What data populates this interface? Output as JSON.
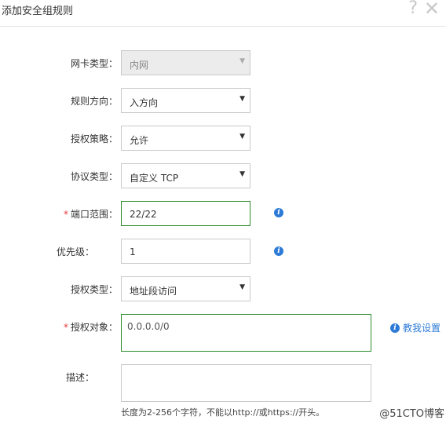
{
  "dialog": {
    "title": "添加安全组规则",
    "help_symbol": "?",
    "close_symbol": "✕"
  },
  "form": {
    "nic_type": {
      "label": "网卡类型：",
      "value": "内网"
    },
    "direction": {
      "label": "规则方向：",
      "value": "入方向"
    },
    "policy": {
      "label": "授权策略：",
      "value": "允许"
    },
    "protocol": {
      "label": "协议类型：",
      "value": "自定义 TCP"
    },
    "port_range": {
      "label": "端口范围：",
      "required_mark": "*",
      "value": "22/22"
    },
    "priority": {
      "label": "优先级：",
      "value": "1"
    },
    "auth_type": {
      "label": "授权类型：",
      "value": "地址段访问"
    },
    "auth_object": {
      "label": "授权对象：",
      "required_mark": "*",
      "value": "0.0.0.0/0",
      "help_link": "教我设置"
    },
    "description": {
      "label": "描述：",
      "value": "",
      "hint": "长度为2-256个字符，不能以http://或https://开头。"
    }
  },
  "watermark": "@51CTO博客",
  "icons": {
    "dropdown": "▼",
    "info": "i"
  },
  "colors": {
    "focus_border": "#2e8b2e",
    "link": "#2d7bd6",
    "required": "#e4393c"
  }
}
